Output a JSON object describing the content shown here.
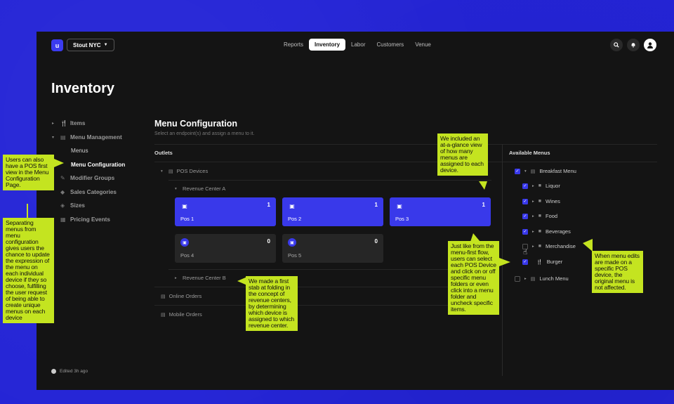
{
  "header": {
    "logo_text": "u",
    "venue": "Stout NYC",
    "tabs": [
      {
        "label": "Reports",
        "active": false
      },
      {
        "label": "Inventory",
        "active": true
      },
      {
        "label": "Labor",
        "active": false
      },
      {
        "label": "Customers",
        "active": false
      },
      {
        "label": "Venue",
        "active": false
      }
    ],
    "icons": [
      "search-icon",
      "bell-icon",
      "user-icon"
    ]
  },
  "page_title": "Inventory",
  "sidebar": {
    "items": [
      {
        "label": "Items",
        "icon": "fork-knife-icon",
        "sub": false,
        "active": false
      },
      {
        "label": "Menu Management",
        "icon": "menu-book-icon",
        "sub": false,
        "active": false
      },
      {
        "label": "Menus",
        "sub": true,
        "active": false
      },
      {
        "label": "Menu Configuration",
        "sub": true,
        "active": true
      },
      {
        "label": "Modifier Groups",
        "icon": "modifier-icon",
        "sub": false,
        "active": false
      },
      {
        "label": "Sales Categories",
        "icon": "tag-icon",
        "sub": false,
        "active": false
      },
      {
        "label": "Sizes",
        "icon": "size-icon",
        "sub": false,
        "active": false
      },
      {
        "label": "Pricing Events",
        "icon": "calendar-icon",
        "sub": false,
        "active": false
      }
    ],
    "edited": "Edited 3h ago"
  },
  "main": {
    "title": "Menu Configuration",
    "subtitle": "Select an endpoint(s) and assign a menu to it.",
    "outlets_label": "Outlets",
    "menus_label": "Available Menus",
    "pos_devices": "POS Devices",
    "revenue_center_a": "Revenue Center A",
    "revenue_center_b": "Revenue Center B",
    "online_orders": "Online Orders",
    "mobile_orders": "Mobile Orders",
    "devices": [
      {
        "name": "Pos 1",
        "count": "1",
        "selected": true
      },
      {
        "name": "Pos 2",
        "count": "1",
        "selected": true
      },
      {
        "name": "Pos 3",
        "count": "1",
        "selected": true
      },
      {
        "name": "Pos 4",
        "count": "0",
        "selected": false
      },
      {
        "name": "Pos 5",
        "count": "0",
        "selected": false
      }
    ],
    "menus": [
      {
        "label": "Breakfast Menu",
        "checked": true
      },
      {
        "label": "Liquor",
        "checked": true
      },
      {
        "label": "Wines",
        "checked": true
      },
      {
        "label": "Food",
        "checked": true
      },
      {
        "label": "Beverages",
        "checked": true
      },
      {
        "label": "Merchandise",
        "checked": false
      },
      {
        "label": "Burger",
        "checked": true
      },
      {
        "label": "Lunch Menu",
        "checked": false
      }
    ]
  },
  "notes": {
    "pos_first": "Users can also have a POS first view in the Menu Configuration Page.",
    "separating": "Separating menus from menu configuration gives users the chance to update the expression of the menu on each individual device if they so choose, fulfilling the user request of being able to create unique menus on each device",
    "at_a_glance": "We included an at-a-glance view of how many menus are assigned to each device.",
    "folding": "We made a first stab at folding in the concept of revenue centers, by determining which device is assigned to which revenue center.",
    "menu_first": "Just like from the menu-first flow, users can select each POS Device and click on or off specific menu folders or even click into a menu folder and uncheck specific items.",
    "menu_edits": "When menu edits are made on a specific POS device, the original menu is not affected."
  },
  "colors": {
    "accent": "#3939ea",
    "note": "#c4e420",
    "background": "#2424d6",
    "panel": "#141414"
  }
}
